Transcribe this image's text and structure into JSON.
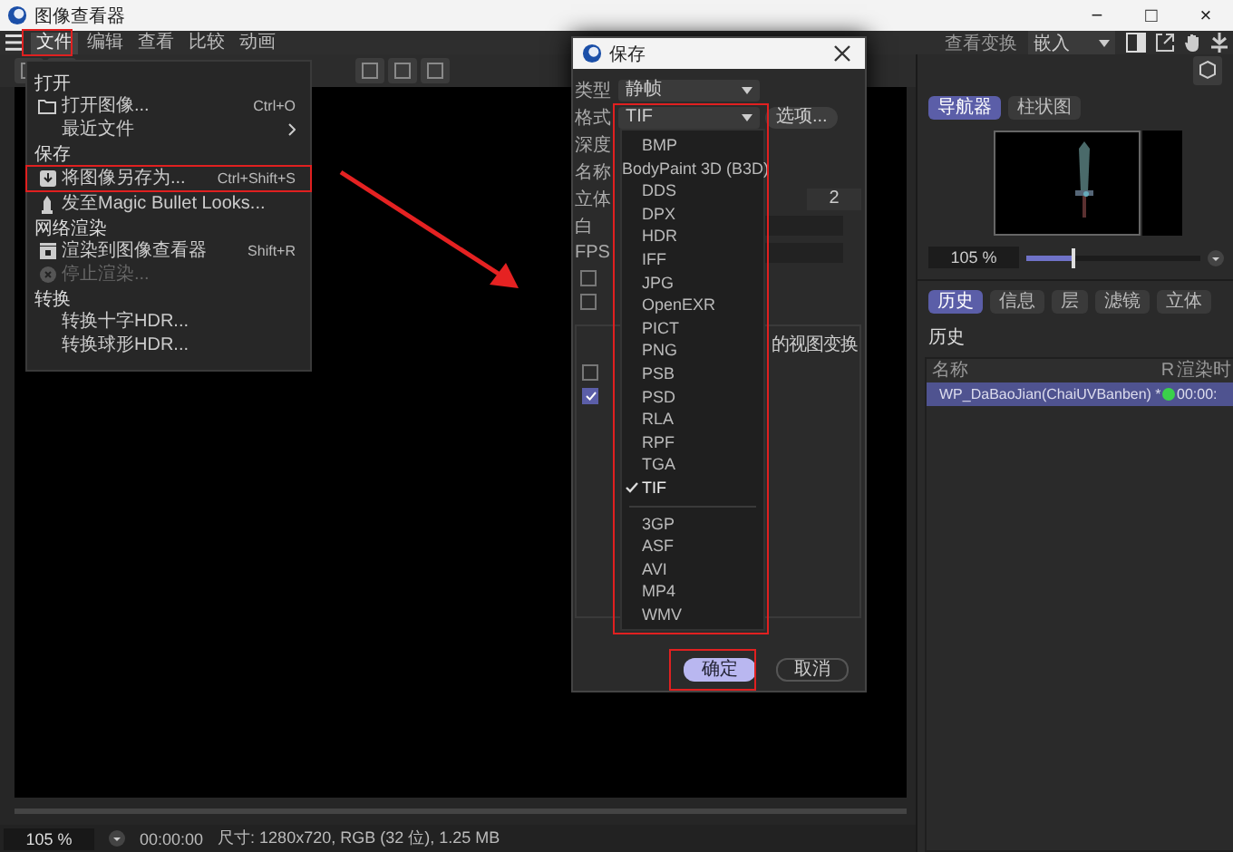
{
  "window": {
    "title": "图像查看器",
    "controls": [
      "−",
      "□",
      "×"
    ]
  },
  "menu_bar": {
    "items": [
      {
        "label": "文件",
        "selected": true
      },
      {
        "label": "编辑",
        "selected": false
      },
      {
        "label": "查看",
        "selected": false
      },
      {
        "label": "比较",
        "selected": false
      },
      {
        "label": "动画",
        "selected": false
      }
    ],
    "view_transform_label": "查看变换",
    "view_transform_value": "嵌入"
  },
  "file_menu": {
    "sections": [
      {
        "title": "打开",
        "items": [
          {
            "label": "打开图像...",
            "shortcut": "Ctrl+O",
            "disabled": false,
            "submenu": false
          },
          {
            "label": "最近文件",
            "disabled": false,
            "submenu": true
          }
        ]
      },
      {
        "title": "保存",
        "items": [
          {
            "label": "将图像另存为...",
            "shortcut": "Ctrl+Shift+S",
            "disabled": false,
            "submenu": false
          },
          {
            "label": "发至Magic Bullet Looks...",
            "disabled": false,
            "submenu": false
          }
        ]
      },
      {
        "title": "网络渲染",
        "items": [
          {
            "label": "渲染到图像查看器",
            "shortcut": "Shift+R",
            "disabled": false,
            "submenu": false
          },
          {
            "label": "停止渲染...",
            "disabled": true,
            "submenu": false
          }
        ]
      },
      {
        "title": "转换",
        "items": [
          {
            "label": "转换十字HDR...",
            "disabled": false,
            "submenu": false
          },
          {
            "label": "转换球形HDR...",
            "disabled": false,
            "submenu": false
          }
        ]
      }
    ]
  },
  "save_dialog": {
    "title": "保存",
    "type_label": "类型",
    "type_value": "静帧",
    "format_label": "格式",
    "format_value": "TIF",
    "options_button": "选项...",
    "labels": [
      "深度",
      "名称",
      "立体",
      "白",
      "FPS"
    ],
    "stereo_value": "2",
    "view_transform_text": "的视图变换",
    "confirm": "确定",
    "cancel": "取消",
    "checkboxes": [
      {
        "checked": false
      },
      {
        "checked": false
      },
      {
        "checked": false
      },
      {
        "checked": true
      }
    ],
    "format_list": [
      {
        "label": "BMP",
        "checked": false
      },
      {
        "label": "BodyPaint 3D (B3D)",
        "checked": false
      },
      {
        "label": "DDS",
        "checked": false
      },
      {
        "label": "DPX",
        "checked": false
      },
      {
        "label": "HDR",
        "checked": false
      },
      {
        "label": "IFF",
        "checked": false
      },
      {
        "label": "JPG",
        "checked": false
      },
      {
        "label": "OpenEXR",
        "checked": false
      },
      {
        "label": "PICT",
        "checked": false
      },
      {
        "label": "PNG",
        "checked": false
      },
      {
        "label": "PSB",
        "checked": false
      },
      {
        "label": "PSD",
        "checked": false
      },
      {
        "label": "RLA",
        "checked": false
      },
      {
        "label": "RPF",
        "checked": false
      },
      {
        "label": "TGA",
        "checked": false
      },
      {
        "label": "TIF",
        "checked": true
      },
      {
        "label": "3GP",
        "checked": false,
        "separator_before": true
      },
      {
        "label": "ASF",
        "checked": false
      },
      {
        "label": "AVI",
        "checked": false
      },
      {
        "label": "MP4",
        "checked": false
      },
      {
        "label": "WMV",
        "checked": false
      }
    ]
  },
  "right_panel": {
    "top_tabs": [
      {
        "label": "导航器",
        "selected": true
      },
      {
        "label": "柱状图",
        "selected": false
      }
    ],
    "navigator": {
      "kind": "picture"
    },
    "zoom": "105 %",
    "zoom_slider": {
      "level": 0.27
    },
    "tabs": [
      {
        "label": "历史",
        "selected": true
      },
      {
        "label": "信息",
        "selected": false
      },
      {
        "label": "层",
        "selected": false
      },
      {
        "label": "滤镜",
        "selected": false
      },
      {
        "label": "立体",
        "selected": false
      }
    ],
    "history_title": "历史",
    "columns": [
      "名称",
      "R",
      "渲染时"
    ],
    "rows": [
      {
        "name": "WP_DaBaoJian(ChaiUVBanben) *",
        "time": "00:00:",
        "color": "#3ad14a",
        "selected": true
      }
    ]
  },
  "status_bar": {
    "zoom": "105 %",
    "time": "00:00:00",
    "info": "尺寸: 1280x720, RGB (32 位), 1.25 MB"
  }
}
